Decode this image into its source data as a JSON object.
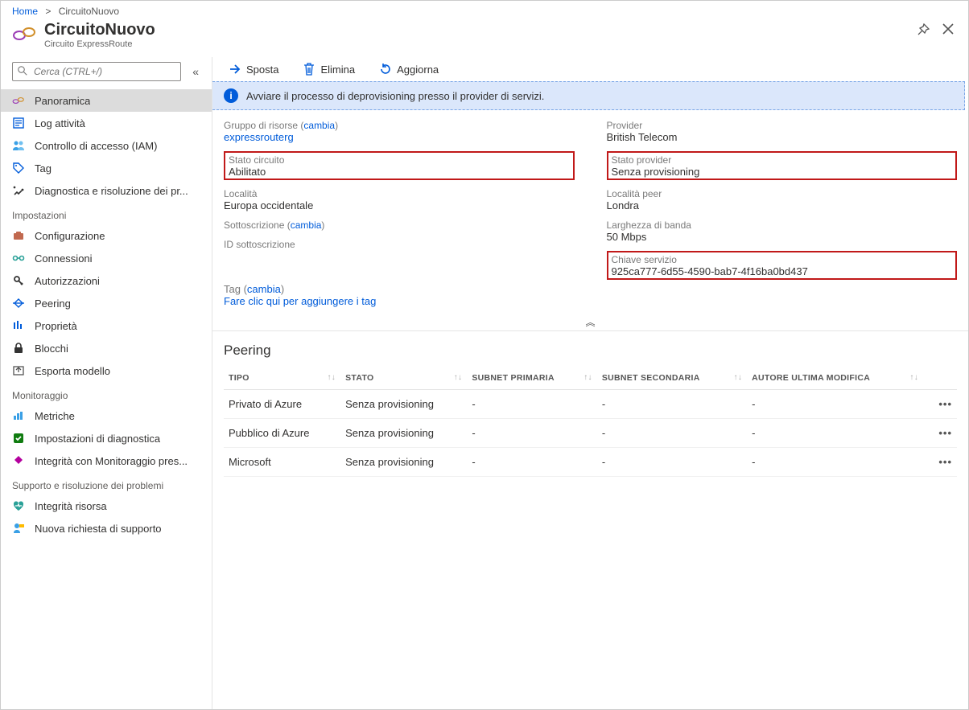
{
  "breadcrumb": {
    "home": "Home",
    "current": "CircuitoNuovo"
  },
  "header": {
    "title": "CircuitoNuovo",
    "subtitle": "Circuito ExpressRoute"
  },
  "search": {
    "placeholder": "Cerca (CTRL+/)"
  },
  "nav": {
    "top": [
      {
        "id": "panoramica",
        "label": "Panoramica",
        "active": true
      },
      {
        "id": "log-attivita",
        "label": "Log attività"
      },
      {
        "id": "iam",
        "label": "Controllo di accesso (IAM)"
      },
      {
        "id": "tag",
        "label": "Tag"
      },
      {
        "id": "diagnostica",
        "label": "Diagnostica e risoluzione dei pr..."
      }
    ],
    "sections": [
      {
        "title": "Impostazioni",
        "items": [
          {
            "id": "configurazione",
            "label": "Configurazione"
          },
          {
            "id": "connessioni",
            "label": "Connessioni"
          },
          {
            "id": "autorizzazioni",
            "label": "Autorizzazioni"
          },
          {
            "id": "peering",
            "label": "Peering"
          },
          {
            "id": "proprieta",
            "label": "Proprietà"
          },
          {
            "id": "blocchi",
            "label": "Blocchi"
          },
          {
            "id": "esporta-modello",
            "label": "Esporta modello"
          }
        ]
      },
      {
        "title": "Monitoraggio",
        "items": [
          {
            "id": "metriche",
            "label": "Metriche"
          },
          {
            "id": "diag-settings",
            "label": "Impostazioni di diagnostica"
          },
          {
            "id": "integrita-mon",
            "label": "Integrità con Monitoraggio pres..."
          }
        ]
      },
      {
        "title": "Supporto e risoluzione dei problemi",
        "items": [
          {
            "id": "integrita-risorsa",
            "label": "Integrità risorsa"
          },
          {
            "id": "nuova-richiesta",
            "label": "Nuova richiesta di supporto"
          }
        ]
      }
    ]
  },
  "toolbar": {
    "move": "Sposta",
    "delete": "Elimina",
    "refresh": "Aggiorna"
  },
  "banner": "Avviare il processo di deprovisioning presso il provider di servizi.",
  "props": {
    "left": {
      "rg_label": "Gruppo di risorse",
      "change": "cambia",
      "rg_value": "expressrouterg",
      "circuit_state_label": "Stato circuito",
      "circuit_state_value": "Abilitato",
      "loc_label": "Località",
      "loc_value": "Europa occidentale",
      "sub_label": "Sottoscrizione",
      "subid_label": "ID sottoscrizione"
    },
    "right": {
      "provider_label": "Provider",
      "provider_value": "British Telecom",
      "prov_state_label": "Stato provider",
      "prov_state_value": "Senza provisioning",
      "peer_loc_label": "Località peer",
      "peer_loc_value": "Londra",
      "bw_label": "Larghezza di banda",
      "bw_value": "50 Mbps",
      "svc_key_label": "Chiave servizio",
      "svc_key_value": "925ca777-6d55-4590-bab7-4f16ba0bd437"
    },
    "tag_label": "Tag",
    "tag_change": "cambia",
    "tag_add": "Fare clic qui per aggiungere i tag"
  },
  "peering": {
    "heading": "Peering",
    "columns": {
      "type": "TIPO",
      "state": "STATO",
      "primary": "SUBNET PRIMARIA",
      "secondary": "SUBNET SECONDARIA",
      "modified": "AUTORE ULTIMA MODIFICA"
    },
    "rows": [
      {
        "type": "Privato di Azure",
        "state": "Senza provisioning",
        "primary": "-",
        "secondary": "-",
        "modified": "-"
      },
      {
        "type": "Pubblico di Azure",
        "state": "Senza provisioning",
        "primary": "-",
        "secondary": "-",
        "modified": "-"
      },
      {
        "type": "Microsoft",
        "state": "Senza provisioning",
        "primary": "-",
        "secondary": "-",
        "modified": "-"
      }
    ]
  }
}
